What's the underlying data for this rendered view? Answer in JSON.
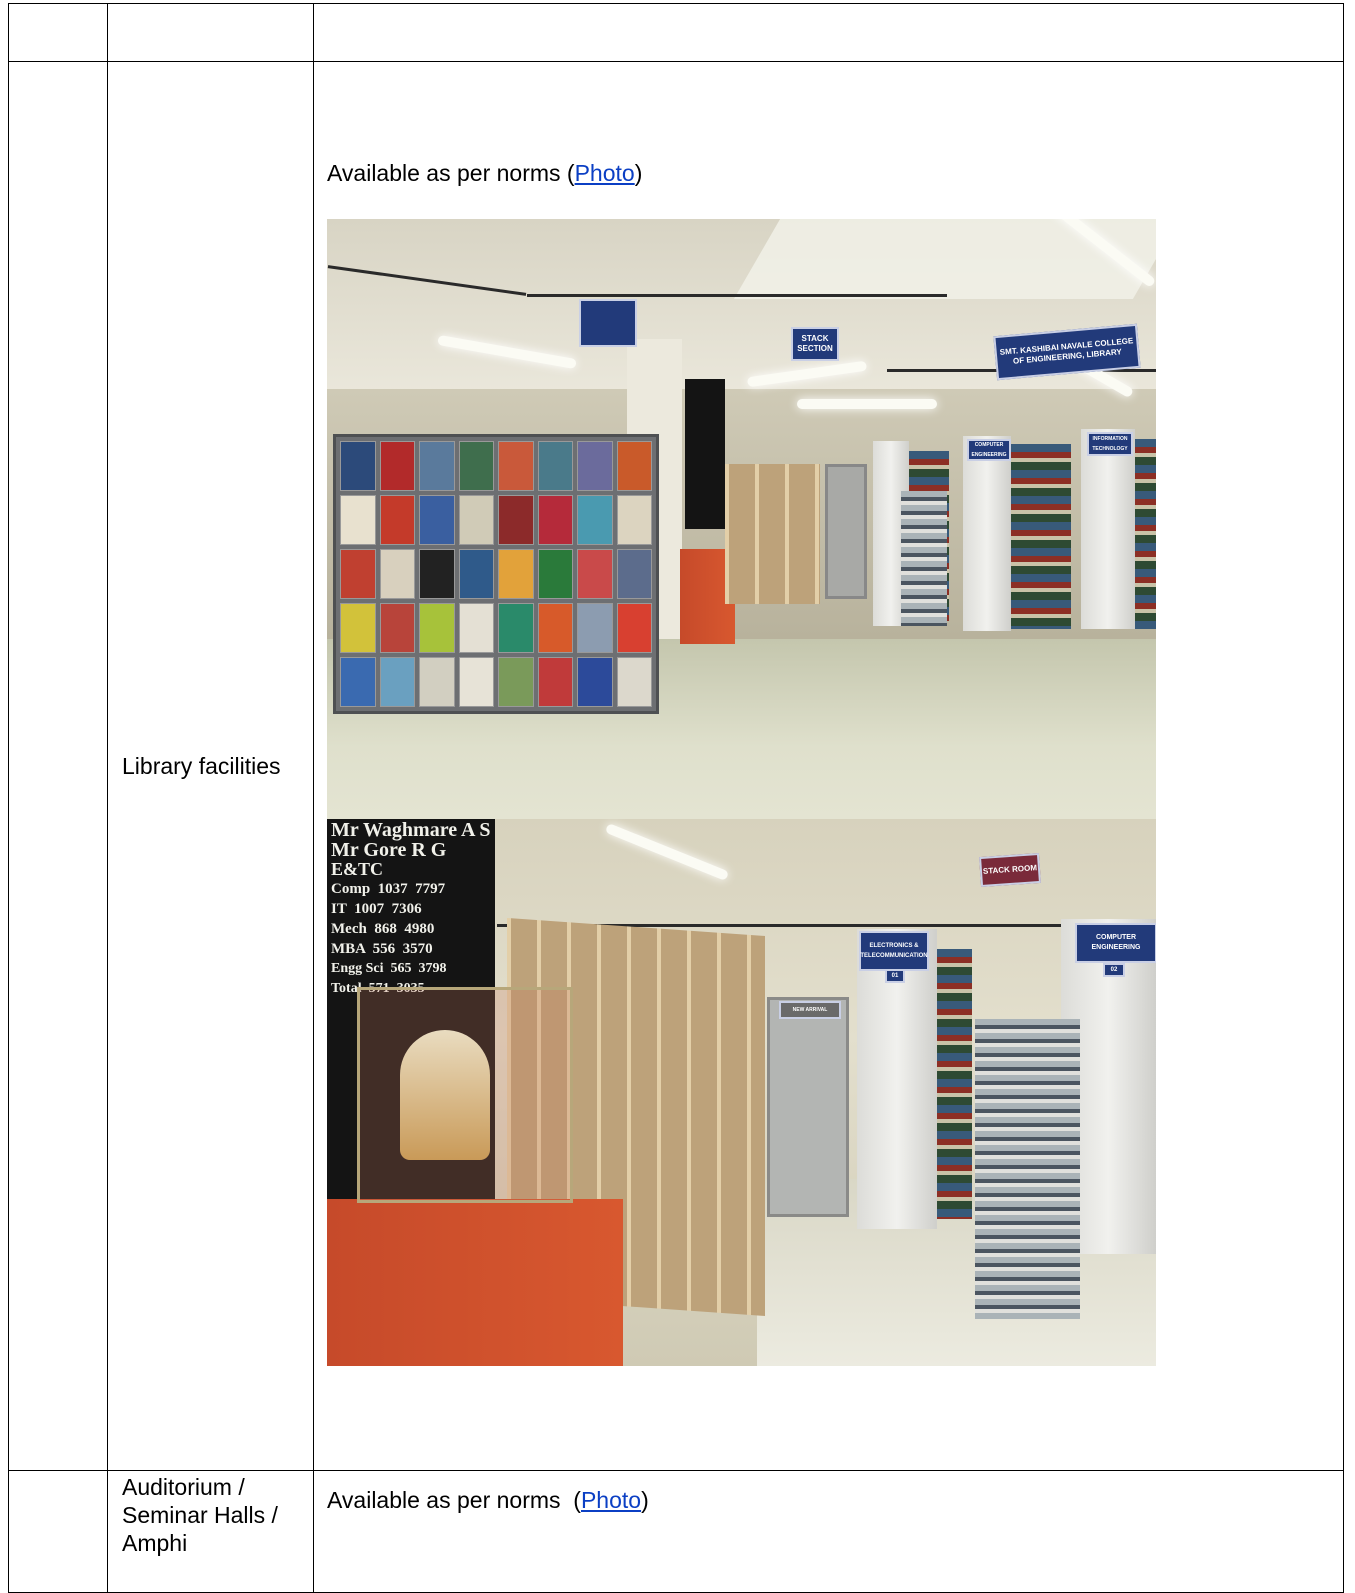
{
  "rows": [
    {
      "col2": "",
      "col3": ""
    },
    {
      "label": "Library facilities",
      "availability_text": "Available as per norms (",
      "photo_link": "Photo",
      "closing": ")",
      "photos": [
        {
          "signs": [
            "STACK SECTION",
            "SMT. KASHIBAI NAVALE COLLEGE OF ENGINEERING, LIBRARY",
            "COMPUTER ENGINEERING",
            "INFORMATION TECHNOLOGY"
          ]
        },
        {
          "signs": [
            "STACK ROOM",
            "ELECTRONICS & TELECOMMUNICATION",
            "01",
            "COMPUTER ENGINEERING",
            "02",
            "NEW ARRIVAL"
          ],
          "board_lines": [
            "Mr Waghmare A S",
            "Mr Gore R G",
            "E&TC",
            "Comp  1037  7797",
            "IT  1007  7306",
            "Mech  868  4980",
            "MBA  556  3570",
            "Engg Sci  565  3798",
            "Total  571  3035"
          ]
        }
      ]
    },
    {
      "label": "Auditorium / Seminar Halls / Amphi",
      "availability_text": "Available as per norms  (",
      "photo_link": "Photo",
      "closing": ")"
    }
  ],
  "colors": {
    "link": "#0b3fc4",
    "border": "#000000",
    "sign_blue": "#223a7a",
    "counter_red": "#c64a2a"
  }
}
